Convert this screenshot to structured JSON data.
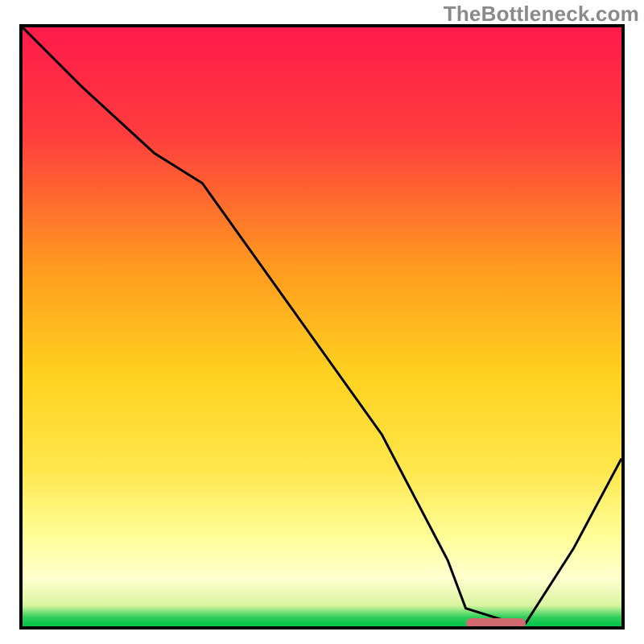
{
  "watermark": "TheBottleneck.com",
  "chart_data": {
    "type": "line",
    "title": "",
    "xlabel": "",
    "ylabel": "",
    "xlim": [
      0,
      100
    ],
    "ylim": [
      0,
      100
    ],
    "grid": false,
    "legend": false,
    "background": {
      "type": "vertical-gradient",
      "description": "red (top) → orange → yellow → pale-yellow → green (bottom band)",
      "stops": [
        {
          "offset": 0.0,
          "color": "#ff1a4b"
        },
        {
          "offset": 0.18,
          "color": "#ff3d3d"
        },
        {
          "offset": 0.4,
          "color": "#ff9a1f"
        },
        {
          "offset": 0.58,
          "color": "#ffd21f"
        },
        {
          "offset": 0.74,
          "color": "#ffe74d"
        },
        {
          "offset": 0.85,
          "color": "#ffff99"
        },
        {
          "offset": 0.92,
          "color": "#ffffd0"
        },
        {
          "offset": 0.965,
          "color": "#d9f5a0"
        },
        {
          "offset": 0.985,
          "color": "#2ecf5a"
        },
        {
          "offset": 1.0,
          "color": "#00c24a"
        }
      ]
    },
    "series": [
      {
        "name": "curve",
        "stroke": "#000000",
        "stroke_width": 3,
        "x": [
          0,
          10,
          22,
          30,
          45,
          60,
          71,
          74,
          82,
          84,
          92,
          100
        ],
        "y": [
          100,
          90,
          79,
          74,
          53,
          32,
          11,
          3,
          0.5,
          0.5,
          13,
          28
        ]
      }
    ],
    "annotations": [
      {
        "type": "marker-pill",
        "name": "bottleneck-marker",
        "color": "#cf6a6f",
        "x_start": 74,
        "x_end": 84,
        "y": 0.5
      }
    ]
  }
}
